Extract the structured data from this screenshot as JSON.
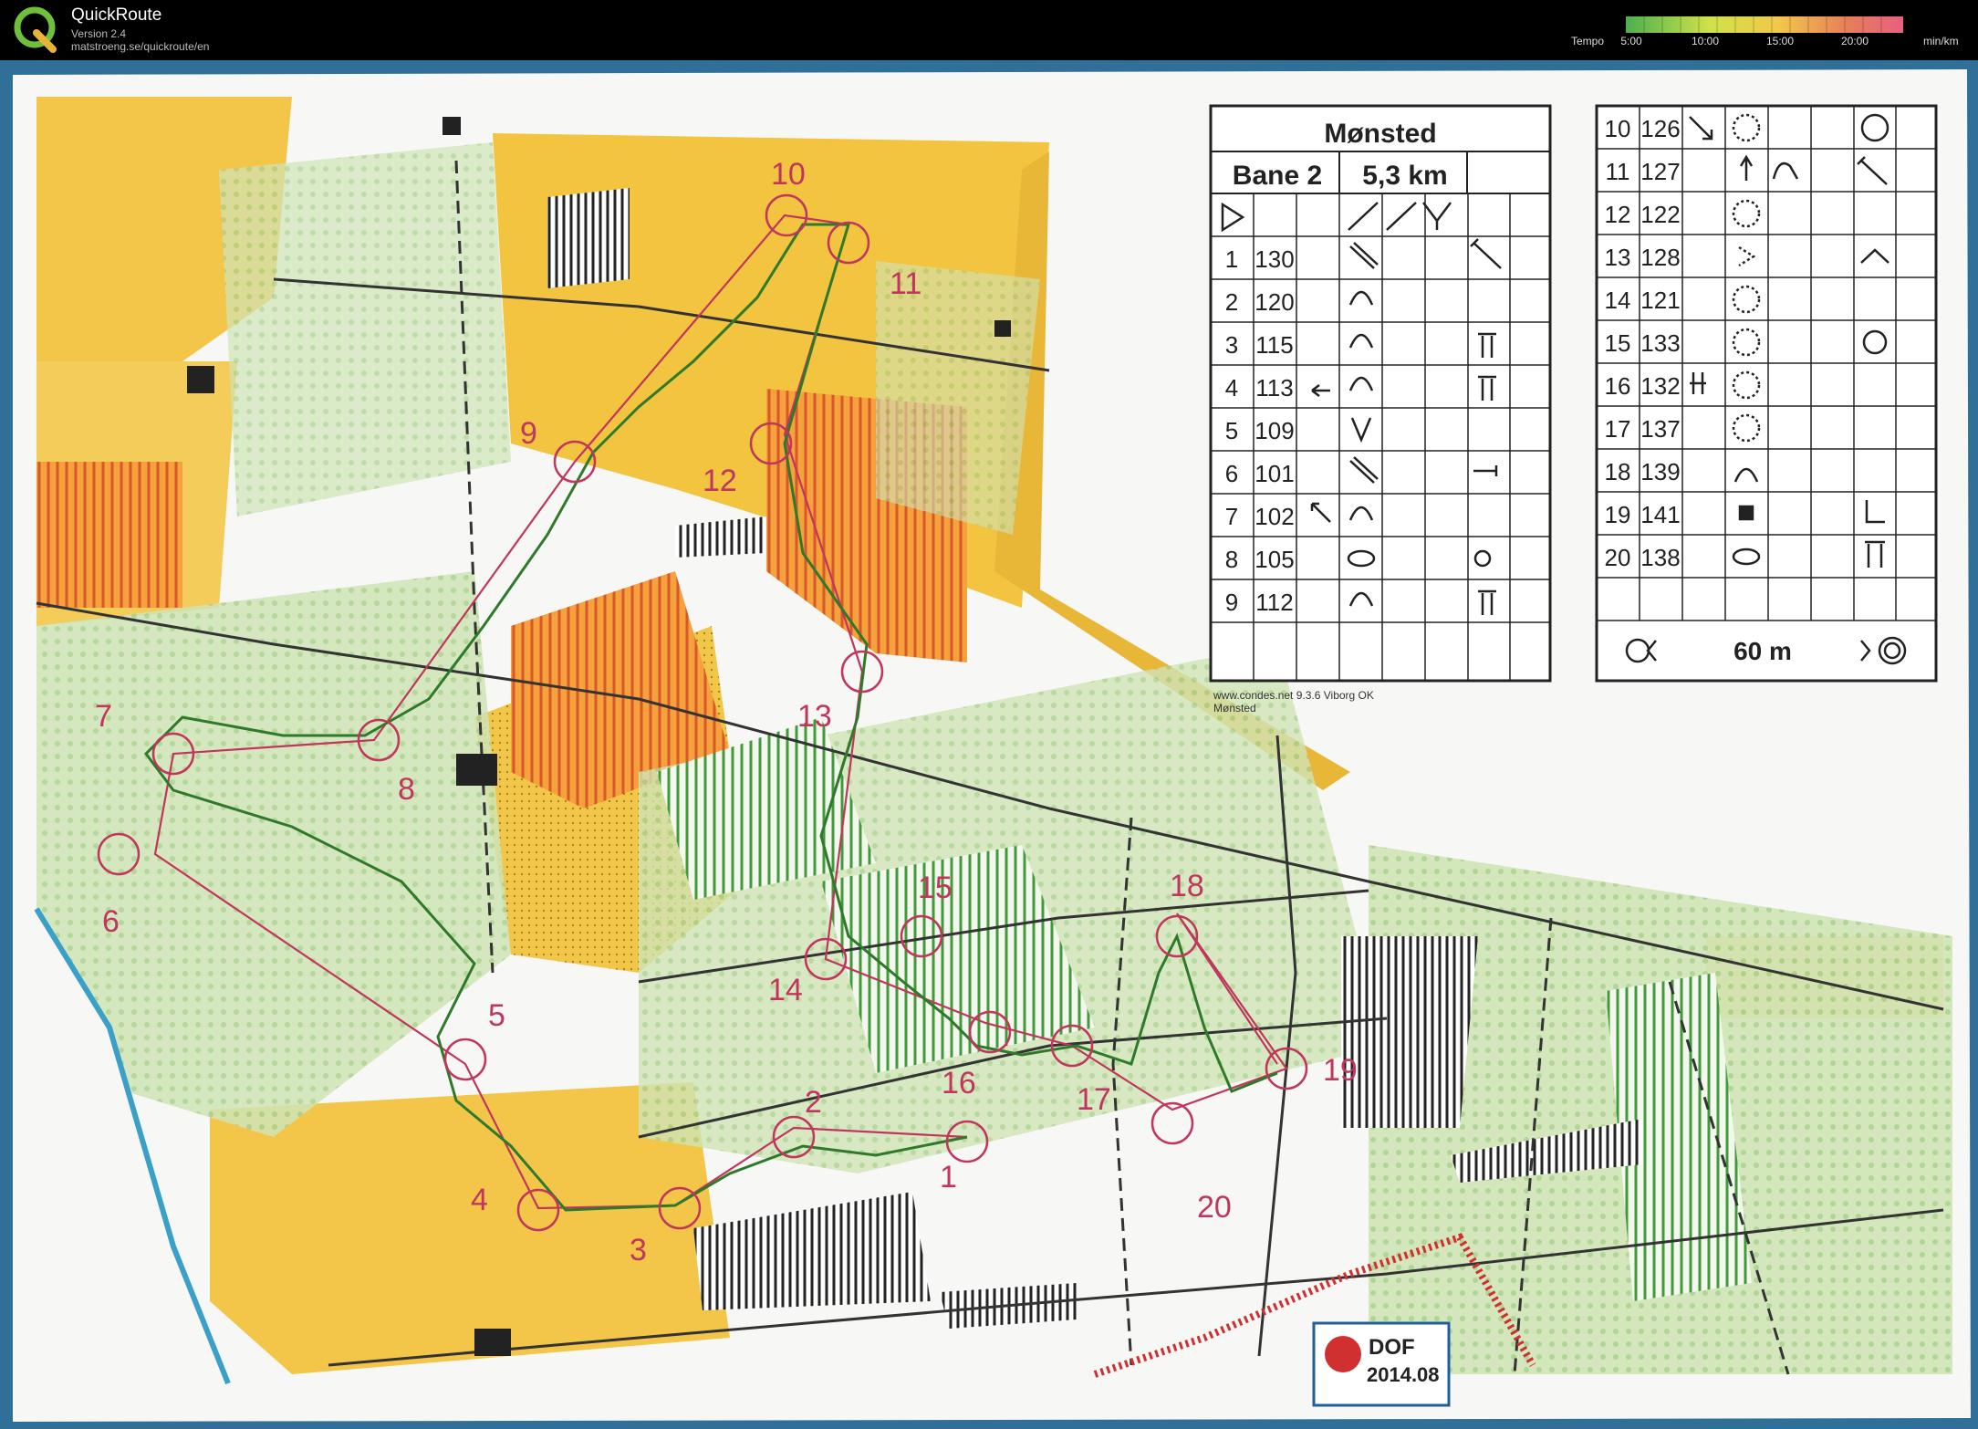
{
  "app": {
    "title": "QuickRoute",
    "version": "Version 2.4",
    "url": "matstroeng.se/quickroute/en",
    "logo_icon": "quickroute-q-logo"
  },
  "tempo": {
    "label": "Tempo",
    "ticks": [
      "5:00",
      "10:00",
      "15:00",
      "20:00"
    ],
    "unit": "min/km",
    "gradient_colors": [
      "#4caf50",
      "#cfe24a",
      "#f2c84b",
      "#e67e5a",
      "#d44a5a"
    ]
  },
  "map": {
    "route_color": "#2f7a2a",
    "course_color": "#c0365c",
    "control_labels": [
      "1",
      "2",
      "3",
      "4",
      "5",
      "6",
      "7",
      "8",
      "9",
      "10",
      "11",
      "12",
      "13",
      "14",
      "15",
      "16",
      "17",
      "18",
      "19",
      "20"
    ]
  },
  "description_sheet": {
    "event": "Mønsted",
    "course": "Bane 2",
    "length": "5,3 km",
    "rows_left": [
      {
        "n": "1",
        "code": "130"
      },
      {
        "n": "2",
        "code": "120"
      },
      {
        "n": "3",
        "code": "115"
      },
      {
        "n": "4",
        "code": "113"
      },
      {
        "n": "5",
        "code": "109"
      },
      {
        "n": "6",
        "code": "101"
      },
      {
        "n": "7",
        "code": "102"
      },
      {
        "n": "8",
        "code": "105"
      },
      {
        "n": "9",
        "code": "112"
      }
    ],
    "rows_right": [
      {
        "n": "10",
        "code": "126"
      },
      {
        "n": "11",
        "code": "127"
      },
      {
        "n": "12",
        "code": "122"
      },
      {
        "n": "13",
        "code": "128"
      },
      {
        "n": "14",
        "code": "121"
      },
      {
        "n": "15",
        "code": "133"
      },
      {
        "n": "16",
        "code": "132"
      },
      {
        "n": "17",
        "code": "137"
      },
      {
        "n": "18",
        "code": "139"
      },
      {
        "n": "19",
        "code": "141"
      },
      {
        "n": "20",
        "code": "138"
      }
    ],
    "finish_distance": "60 m",
    "footer_line1": "www.condes.net 9.3.6 Viborg OK",
    "footer_line2": "Mønsted"
  },
  "badge": {
    "org": "DOF",
    "code": "2014.08"
  }
}
